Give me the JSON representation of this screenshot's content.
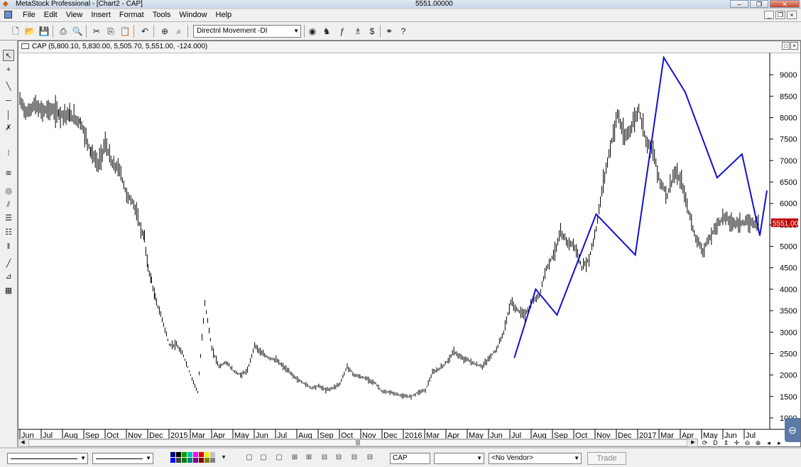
{
  "titlebar": {
    "app_title": "MetaStock Professional - [Chart2 - CAP]",
    "price": "5551.00000"
  },
  "menu": {
    "items": [
      "File",
      "Edit",
      "View",
      "Insert",
      "Format",
      "Tools",
      "Window",
      "Help"
    ]
  },
  "toolbar": {
    "indicator": "Directnl Movement -DI"
  },
  "chart": {
    "header": "CAP (5,800.10, 5,830.00, 5,505.70, 5,551.00, -124.000)",
    "last_price": "5551.00",
    "colors": {
      "bars": "#000000",
      "zigzag": "#1010d0",
      "price_tag": "#c00000"
    }
  },
  "chart_data": {
    "type": "line",
    "title": "CAP",
    "yticks": [
      1000,
      1500,
      2000,
      2500,
      3000,
      3500,
      4000,
      4500,
      5000,
      5500,
      6000,
      6500,
      7000,
      7500,
      8000,
      8500,
      9000
    ],
    "ylim": [
      900,
      9450
    ],
    "xticks": [
      "Jun",
      "Jul",
      "Aug",
      "Sep",
      "Oct",
      "Nov",
      "Dec",
      "2015",
      "Mar",
      "Apr",
      "May",
      "Jun",
      "Jul",
      "Aug",
      "Sep",
      "Oct",
      "Nov",
      "Dec",
      "2016",
      "Mar",
      "Apr",
      "May",
      "Jun",
      "Jul",
      "Aug",
      "Sep",
      "Oct",
      "Nov",
      "Dec",
      "2017",
      "Mar",
      "Apr",
      "May",
      "Jun",
      "Jul"
    ],
    "series": [
      {
        "style": "bars",
        "x": [
          0,
          10,
          20,
          30,
          40,
          55,
          70,
          85,
          100,
          110,
          120,
          130,
          140,
          150,
          160,
          170,
          175,
          180,
          185,
          190,
          200,
          210,
          220,
          230,
          240,
          250,
          260,
          270,
          280,
          290,
          300,
          310,
          320,
          330,
          340,
          350,
          360,
          370,
          380,
          390,
          400,
          410,
          420,
          430,
          440,
          450,
          460,
          470,
          480,
          490,
          500,
          510,
          520,
          530,
          540,
          550,
          560,
          570,
          580,
          590,
          600,
          610,
          620,
          630,
          640,
          650,
          660,
          670,
          680,
          690,
          700,
          710,
          720,
          730,
          740,
          750,
          760,
          770,
          780,
          790,
          800,
          810,
          820,
          830,
          840,
          850,
          860,
          870,
          880,
          890,
          900,
          910,
          920,
          930,
          940,
          950,
          960,
          970,
          980,
          990,
          1000,
          1010,
          1020,
          1030,
          1040
        ],
        "y": [
          8400,
          8100,
          8300,
          8150,
          8200,
          8100,
          8050,
          7900,
          7200,
          6900,
          7400,
          6900,
          6800,
          6200,
          6000,
          5400,
          5200,
          4500,
          4200,
          3800,
          3300,
          2700,
          2700,
          2450,
          2000,
          1600,
          3700,
          2600,
          2200,
          2300,
          2100,
          2000,
          2100,
          2700,
          2500,
          2400,
          2350,
          2200,
          2050,
          1900,
          1800,
          1700,
          1750,
          1650,
          1700,
          1800,
          2200,
          2000,
          1950,
          1900,
          1800,
          1600,
          1600,
          1550,
          1500,
          1500,
          1600,
          1650,
          2050,
          2150,
          2300,
          2550,
          2400,
          2350,
          2250,
          2200,
          2400,
          2600,
          3000,
          3700,
          3500,
          3400,
          3700,
          3850,
          4500,
          4800,
          5300,
          5100,
          5000,
          4500,
          4700,
          5400,
          6500,
          7300,
          8100,
          7500,
          7800,
          8200,
          7500,
          7200,
          6500,
          6200,
          6700,
          6500,
          5800,
          5200,
          4900,
          5200,
          5500,
          5700,
          5550,
          5551,
          5551,
          5551,
          5551
        ]
      },
      {
        "style": "zigzag",
        "x": [
          695,
          725,
          755,
          810,
          865,
          905,
          935,
          980,
          1015,
          1040,
          1050
        ],
        "y": [
          2400,
          4000,
          3400,
          5750,
          4800,
          9400,
          8600,
          6600,
          7150,
          5250,
          6300
        ]
      }
    ]
  }
}
